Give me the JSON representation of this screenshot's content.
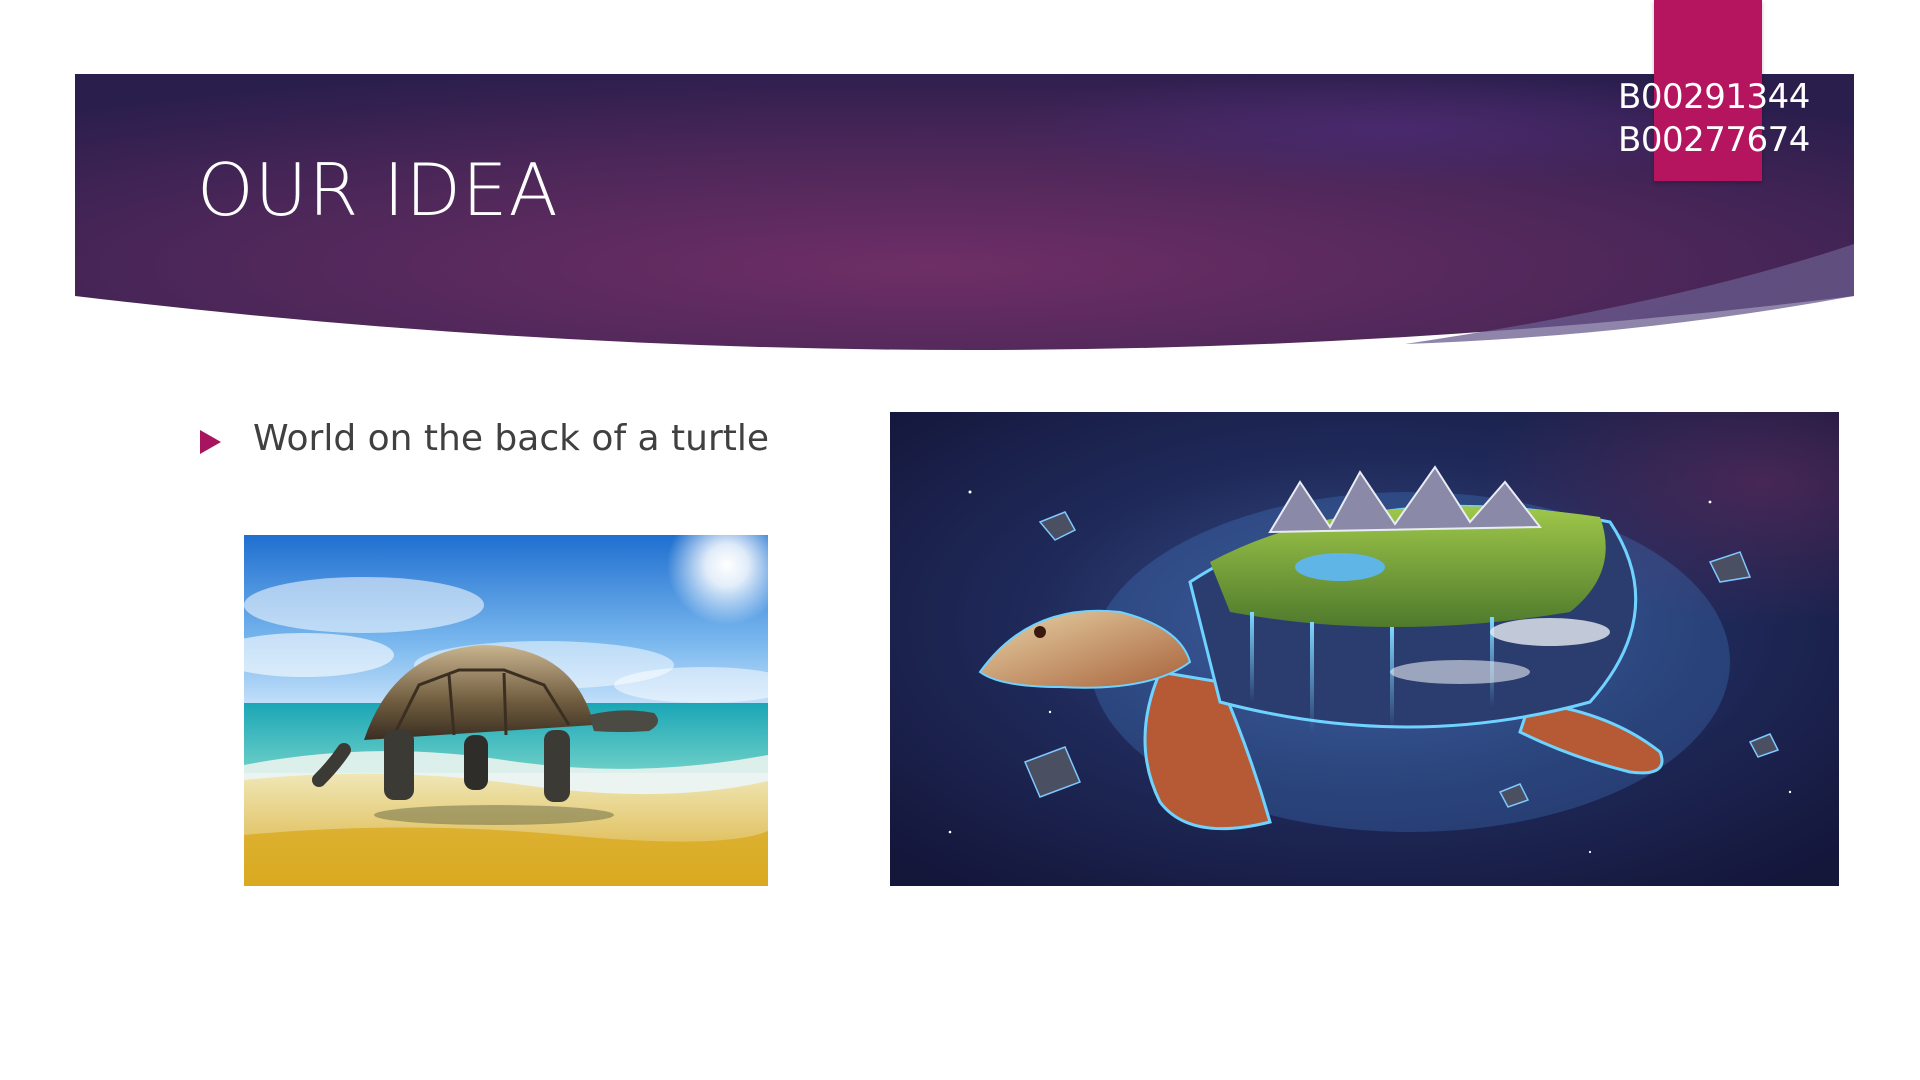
{
  "slide": {
    "title": "OUR IDEA",
    "ids": [
      "B00291344",
      "B00277674"
    ],
    "bullets": [
      {
        "text": "World on the back of a turtle"
      }
    ]
  },
  "images": {
    "left": "tortoise-on-beach-photo",
    "right": "turtle-carrying-world-illustration"
  },
  "colors": {
    "banner_dark": "#2b1f4f",
    "banner_mid": "#6b2b63",
    "accent": "#b5145e",
    "bullet": "#a7155f",
    "text": "#404040"
  }
}
